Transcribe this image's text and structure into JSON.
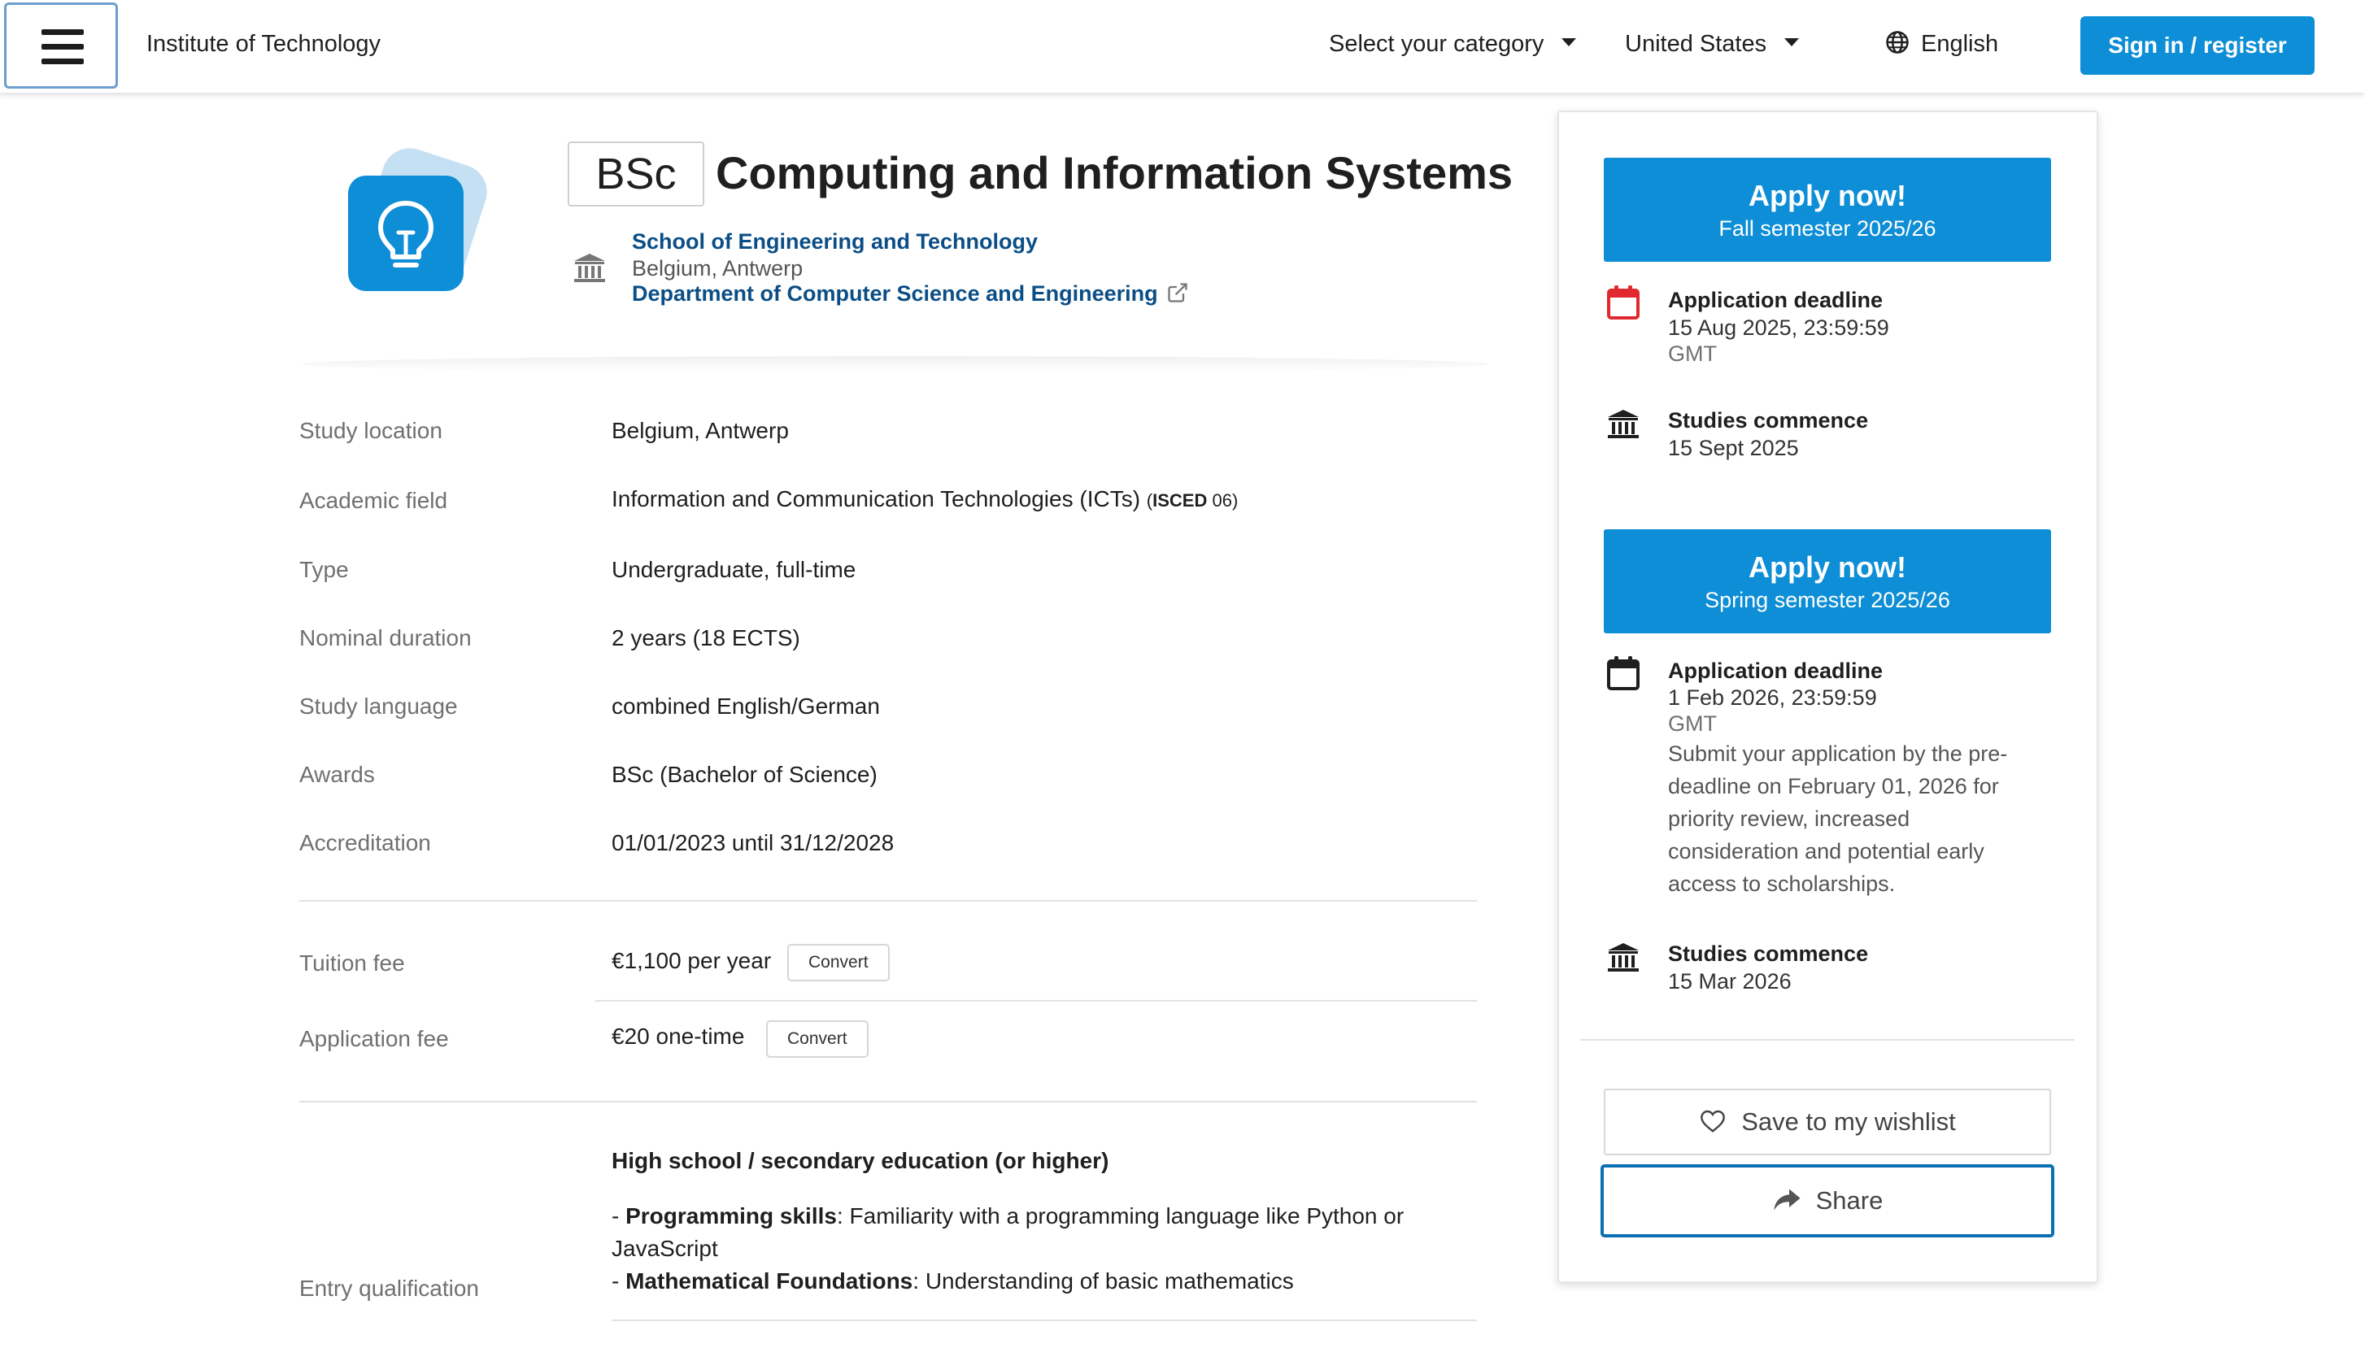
{
  "header": {
    "brand": "Institute of Technology",
    "category_select": "Select your category",
    "country_select": "United States",
    "language": "English",
    "signin_label": "Sign in / register"
  },
  "program": {
    "degree": "BSc",
    "title": "Computing and Information Systems",
    "school": "School of Engineering and Technology",
    "location": "Belgium, Antwerp",
    "department": "Department of Computer Science and Engineering"
  },
  "details": [
    {
      "label": "Study location",
      "value": "Belgium, Antwerp"
    },
    {
      "label": "Academic field",
      "value": "Information and Communication Technologies (ICTs)",
      "isced_label": "ISCED",
      "isced_code": "06"
    },
    {
      "label": "Type",
      "value": "Undergraduate, full-time"
    },
    {
      "label": "Nominal duration",
      "value": "2 years (18 ECTS)"
    },
    {
      "label": "Study language",
      "value": "combined English/German"
    },
    {
      "label": "Awards",
      "value": "BSc (Bachelor of Science)"
    },
    {
      "label": "Accreditation",
      "value": "01/01/2023 until 31/12/2028"
    }
  ],
  "fees": [
    {
      "label": "Tuition fee",
      "value": "€1,100 per year",
      "convert_label": "Convert"
    },
    {
      "label": "Application fee",
      "value": "€20 one-time",
      "convert_label": "Convert"
    }
  ],
  "entry": {
    "label": "Entry qualification",
    "heading": "High school / secondary education (or higher)",
    "req1_bold": "Programming skills",
    "req1_text": ": Familiarity with a programming language like Python or",
    "req1_cont": "JavaScript",
    "req2_bold": "Mathematical Foundations",
    "req2_text": ": Understanding of basic mathematics",
    "dash": "- "
  },
  "sidebar": {
    "intakes": [
      {
        "apply_label": "Apply now!",
        "semester": "Fall semester 2025/26",
        "deadline_label": "Application deadline",
        "deadline": "15 Aug 2025, 23:59:59",
        "timezone": "GMT",
        "commence_label": "Studies commence",
        "commence": "15 Sept 2025"
      },
      {
        "apply_label": "Apply now!",
        "semester": "Spring semester 2025/26",
        "deadline_label": "Application deadline",
        "deadline": "1 Feb 2026, 23:59:59",
        "timezone": "GMT",
        "note": "Submit your application by the pre-deadline on February 01, 2026 for priority review, increased consideration and potential early access to scholarships.",
        "commence_label": "Studies commence",
        "commence": "15 Mar 2026"
      }
    ],
    "wishlist_label": "Save to my wishlist",
    "share_label": "Share"
  },
  "colors": {
    "accent": "#0d8ed6",
    "link": "#0b4e86",
    "deadline_urgent": "#e0282e"
  }
}
